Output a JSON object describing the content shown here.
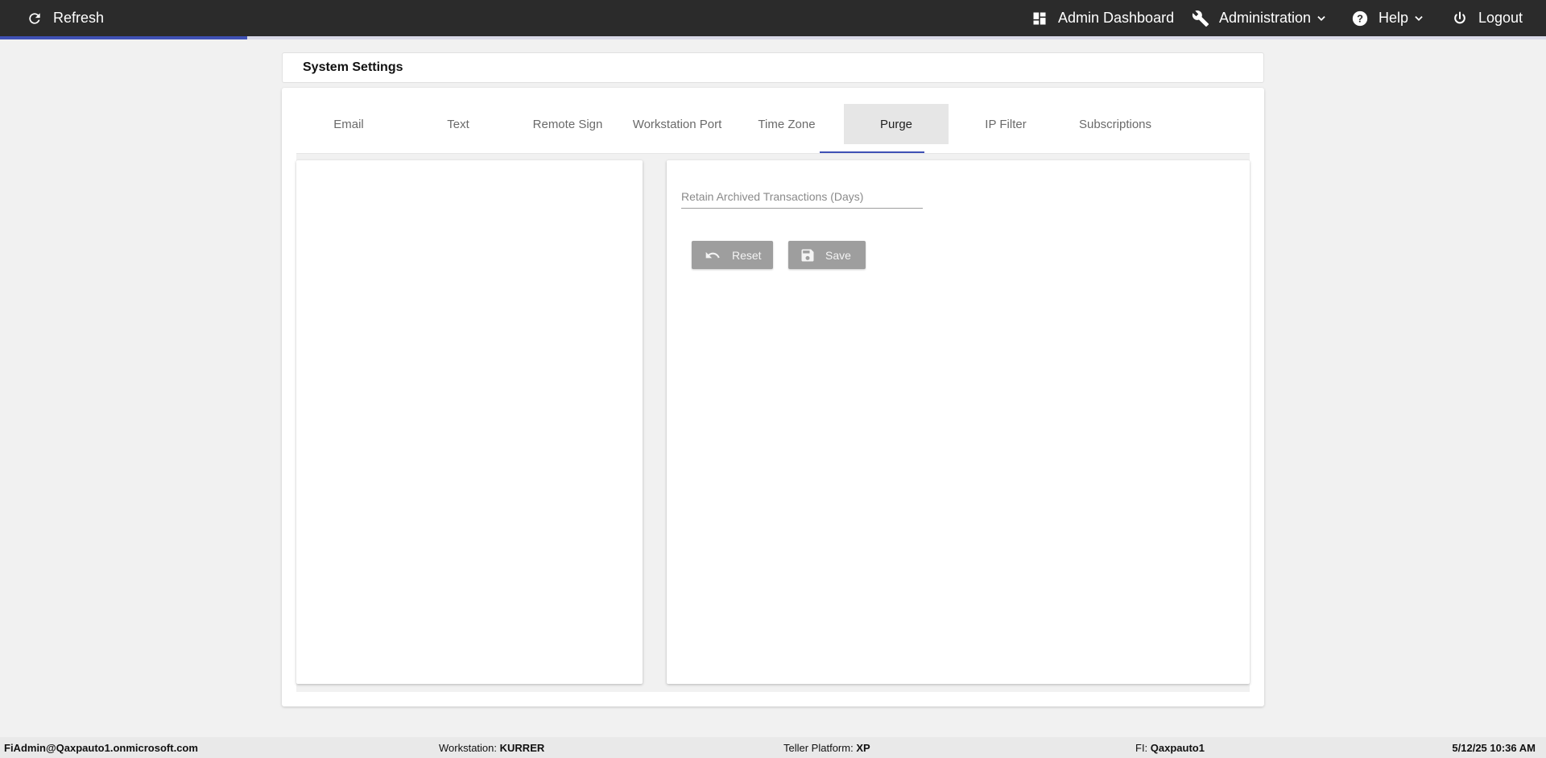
{
  "topbar": {
    "refresh_label": "Refresh",
    "admin_dashboard_label": "Admin Dashboard",
    "administration_label": "Administration",
    "help_label": "Help",
    "logout_label": "Logout",
    "progress": 0.16
  },
  "page": {
    "title": "System Settings"
  },
  "tabs": [
    {
      "label": "Email"
    },
    {
      "label": "Text"
    },
    {
      "label": "Remote Sign"
    },
    {
      "label": "Workstation Port"
    },
    {
      "label": "Time Zone"
    },
    {
      "label": "Purge"
    },
    {
      "label": "IP Filter"
    },
    {
      "label": "Subscriptions"
    }
  ],
  "active_tab": "Purge",
  "purge": {
    "retain_days_placeholder": "Retain Archived Transactions (Days)",
    "retain_days_value": "",
    "reset_label": "Reset",
    "save_label": "Save"
  },
  "statusbar": {
    "user": "FiAdmin@Qaxpauto1.onmicrosoft.com",
    "workstation_label": "Workstation:",
    "workstation_value": "KURRER",
    "teller_platform_label": "Teller Platform:",
    "teller_platform_value": "XP",
    "fi_label": "FI:",
    "fi_value": "Qaxpauto1",
    "datetime": "5/12/25 10:36 AM"
  },
  "colors": {
    "topbar": "#2b2b2b",
    "accent": "#3f51b5",
    "button_disabled": "#9e9e9e"
  }
}
